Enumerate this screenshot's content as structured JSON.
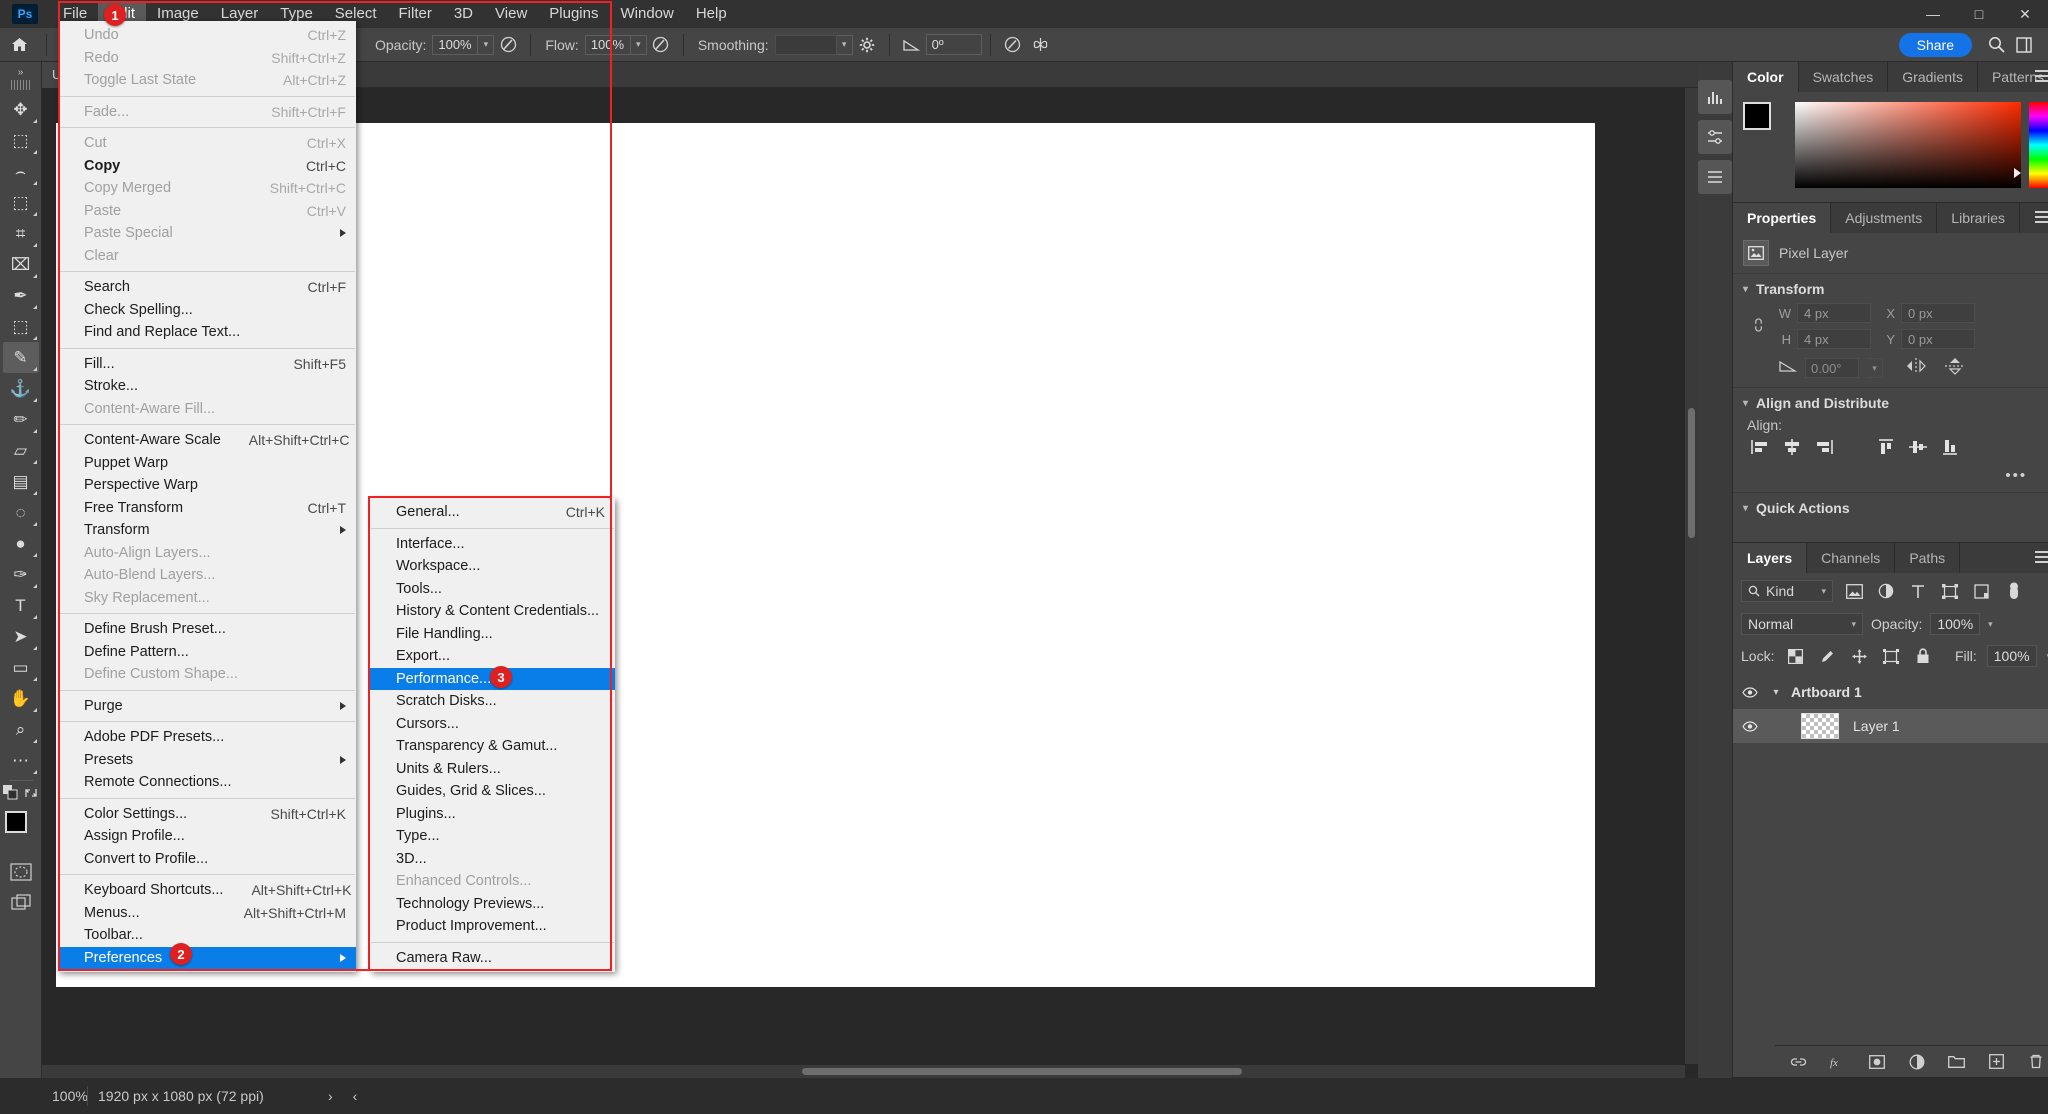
{
  "app": {
    "logo": "Ps"
  },
  "menubar": {
    "items": [
      {
        "label": "File",
        "active": false
      },
      {
        "label": "Edit",
        "active": true
      },
      {
        "label": "Image",
        "active": false
      },
      {
        "label": "Layer",
        "active": false
      },
      {
        "label": "Type",
        "active": false
      },
      {
        "label": "Select",
        "active": false
      },
      {
        "label": "Filter",
        "active": false
      },
      {
        "label": "3D",
        "active": false
      },
      {
        "label": "View",
        "active": false
      },
      {
        "label": "Plugins",
        "active": false
      },
      {
        "label": "Window",
        "active": false
      },
      {
        "label": "Help",
        "active": false
      }
    ]
  },
  "window_controls": {
    "minimize": "—",
    "maximize": "□",
    "close": "✕"
  },
  "options_bar": {
    "opacity_label": "Opacity:",
    "opacity_value": "100%",
    "flow_label": "Flow:",
    "flow_value": "100%",
    "smoothing_label": "Smoothing:",
    "angle_value": "0º",
    "share_label": "Share"
  },
  "document_tab": {
    "label": "U"
  },
  "toolbar": {
    "collapse": "»",
    "tools": [
      {
        "name": "move-tool",
        "glyph": "✥",
        "selected": false
      },
      {
        "name": "rectangular-marquee-tool",
        "glyph": "⬚",
        "selected": false
      },
      {
        "name": "lasso-tool",
        "glyph": "⌢",
        "selected": false
      },
      {
        "name": "object-selection-tool",
        "glyph": "⬚",
        "selected": false
      },
      {
        "name": "crop-tool",
        "glyph": "⌗",
        "selected": false
      },
      {
        "name": "frame-tool",
        "glyph": "⌧",
        "selected": false
      },
      {
        "name": "eyedropper-tool",
        "glyph": "✒",
        "selected": false
      },
      {
        "name": "spot-healing-brush-tool",
        "glyph": "⬚",
        "selected": false
      },
      {
        "name": "brush-tool",
        "glyph": "✎",
        "selected": true
      },
      {
        "name": "clone-stamp-tool",
        "glyph": "⚓",
        "selected": false
      },
      {
        "name": "history-brush-tool",
        "glyph": "✏",
        "selected": false
      },
      {
        "name": "eraser-tool",
        "glyph": "▱",
        "selected": false
      },
      {
        "name": "gradient-tool",
        "glyph": "▤",
        "selected": false
      },
      {
        "name": "blur-tool",
        "glyph": "◌",
        "selected": false
      },
      {
        "name": "dodge-tool",
        "glyph": "●",
        "selected": false
      },
      {
        "name": "pen-tool",
        "glyph": "✑",
        "selected": false
      },
      {
        "name": "horizontal-type-tool",
        "glyph": "T",
        "selected": false
      },
      {
        "name": "path-selection-tool",
        "glyph": "➤",
        "selected": false
      },
      {
        "name": "rectangle-tool",
        "glyph": "▭",
        "selected": false
      },
      {
        "name": "hand-tool",
        "glyph": "✋",
        "selected": false
      },
      {
        "name": "zoom-tool",
        "glyph": "⌕",
        "selected": false
      },
      {
        "name": "edit-toolbar-tool",
        "glyph": "⋯",
        "selected": false
      }
    ]
  },
  "edit_menu": {
    "items": [
      {
        "label": "Undo",
        "shortcut": "Ctrl+Z",
        "dim": true
      },
      {
        "label": "Redo",
        "shortcut": "Shift+Ctrl+Z",
        "dim": true
      },
      {
        "label": "Toggle Last State",
        "shortcut": "Alt+Ctrl+Z",
        "dim": true
      },
      {
        "sep": true
      },
      {
        "label": "Fade...",
        "shortcut": "Shift+Ctrl+F",
        "dim": true
      },
      {
        "sep": true
      },
      {
        "label": "Cut",
        "shortcut": "Ctrl+X",
        "dim": true
      },
      {
        "label": "Copy",
        "shortcut": "Ctrl+C",
        "dim": false,
        "bold": true
      },
      {
        "label": "Copy Merged",
        "shortcut": "Shift+Ctrl+C",
        "dim": true
      },
      {
        "label": "Paste",
        "shortcut": "Ctrl+V",
        "dim": true
      },
      {
        "label": "Paste Special",
        "shortcut": "",
        "dim": true,
        "submenu": true
      },
      {
        "label": "Clear",
        "shortcut": "",
        "dim": true
      },
      {
        "sep": true
      },
      {
        "label": "Search",
        "shortcut": "Ctrl+F",
        "dim": false
      },
      {
        "label": "Check Spelling...",
        "shortcut": "",
        "dim": false
      },
      {
        "label": "Find and Replace Text...",
        "shortcut": "",
        "dim": false
      },
      {
        "sep": true
      },
      {
        "label": "Fill...",
        "shortcut": "Shift+F5",
        "dim": false
      },
      {
        "label": "Stroke...",
        "shortcut": "",
        "dim": false
      },
      {
        "label": "Content-Aware Fill...",
        "shortcut": "",
        "dim": true
      },
      {
        "sep": true
      },
      {
        "label": "Content-Aware Scale",
        "shortcut": "Alt+Shift+Ctrl+C",
        "dim": false
      },
      {
        "label": "Puppet Warp",
        "shortcut": "",
        "dim": false
      },
      {
        "label": "Perspective Warp",
        "shortcut": "",
        "dim": false
      },
      {
        "label": "Free Transform",
        "shortcut": "Ctrl+T",
        "dim": false
      },
      {
        "label": "Transform",
        "shortcut": "",
        "dim": false,
        "submenu": true
      },
      {
        "label": "Auto-Align Layers...",
        "shortcut": "",
        "dim": true
      },
      {
        "label": "Auto-Blend Layers...",
        "shortcut": "",
        "dim": true
      },
      {
        "label": "Sky Replacement...",
        "shortcut": "",
        "dim": true
      },
      {
        "sep": true
      },
      {
        "label": "Define Brush Preset...",
        "shortcut": "",
        "dim": false
      },
      {
        "label": "Define Pattern...",
        "shortcut": "",
        "dim": false
      },
      {
        "label": "Define Custom Shape...",
        "shortcut": "",
        "dim": true
      },
      {
        "sep": true
      },
      {
        "label": "Purge",
        "shortcut": "",
        "dim": false,
        "submenu": true
      },
      {
        "sep": true
      },
      {
        "label": "Adobe PDF Presets...",
        "shortcut": "",
        "dim": false
      },
      {
        "label": "Presets",
        "shortcut": "",
        "dim": false,
        "submenu": true
      },
      {
        "label": "Remote Connections...",
        "shortcut": "",
        "dim": false
      },
      {
        "sep": true
      },
      {
        "label": "Color Settings...",
        "shortcut": "Shift+Ctrl+K",
        "dim": false
      },
      {
        "label": "Assign Profile...",
        "shortcut": "",
        "dim": false
      },
      {
        "label": "Convert to Profile...",
        "shortcut": "",
        "dim": false
      },
      {
        "sep": true
      },
      {
        "label": "Keyboard Shortcuts...",
        "shortcut": "Alt+Shift+Ctrl+K",
        "dim": false
      },
      {
        "label": "Menus...",
        "shortcut": "Alt+Shift+Ctrl+M",
        "dim": false
      },
      {
        "label": "Toolbar...",
        "shortcut": "",
        "dim": false
      },
      {
        "label": "Preferences",
        "shortcut": "",
        "dim": false,
        "submenu": true,
        "highlight": true
      }
    ]
  },
  "preferences_menu": {
    "items": [
      {
        "label": "General...",
        "shortcut": "Ctrl+K",
        "dim": false
      },
      {
        "sep": true
      },
      {
        "label": "Interface...",
        "shortcut": "",
        "dim": false
      },
      {
        "label": "Workspace...",
        "shortcut": "",
        "dim": false
      },
      {
        "label": "Tools...",
        "shortcut": "",
        "dim": false
      },
      {
        "label": "History & Content Credentials...",
        "shortcut": "",
        "dim": false
      },
      {
        "label": "File Handling...",
        "shortcut": "",
        "dim": false
      },
      {
        "label": "Export...",
        "shortcut": "",
        "dim": false
      },
      {
        "label": "Performance...",
        "shortcut": "",
        "dim": false,
        "highlight": true
      },
      {
        "label": "Scratch Disks...",
        "shortcut": "",
        "dim": false
      },
      {
        "label": "Cursors...",
        "shortcut": "",
        "dim": false
      },
      {
        "label": "Transparency & Gamut...",
        "shortcut": "",
        "dim": false
      },
      {
        "label": "Units & Rulers...",
        "shortcut": "",
        "dim": false
      },
      {
        "label": "Guides, Grid & Slices...",
        "shortcut": "",
        "dim": false
      },
      {
        "label": "Plugins...",
        "shortcut": "",
        "dim": false
      },
      {
        "label": "Type...",
        "shortcut": "",
        "dim": false
      },
      {
        "label": "3D...",
        "shortcut": "",
        "dim": false
      },
      {
        "label": "Enhanced Controls...",
        "shortcut": "",
        "dim": true
      },
      {
        "label": "Technology Previews...",
        "shortcut": "",
        "dim": false
      },
      {
        "label": "Product Improvement...",
        "shortcut": "",
        "dim": false
      },
      {
        "sep": true
      },
      {
        "label": "Camera Raw...",
        "shortcut": "",
        "dim": false
      }
    ]
  },
  "annotations": {
    "badges": [
      {
        "number": "1",
        "target": "edit-menu-title"
      },
      {
        "number": "2",
        "target": "preferences-menu-item"
      },
      {
        "number": "3",
        "target": "performance-menu-item"
      }
    ],
    "accent_color": "#ee2222"
  },
  "color_panel": {
    "tabs": [
      {
        "label": "Color",
        "active": true
      },
      {
        "label": "Swatches",
        "active": false
      },
      {
        "label": "Gradients",
        "active": false
      },
      {
        "label": "Patterns",
        "active": false
      }
    ],
    "foreground": "#000000",
    "background": "#ffffff"
  },
  "properties_panel": {
    "tabs": [
      {
        "label": "Properties",
        "active": true
      },
      {
        "label": "Adjustments",
        "active": false
      },
      {
        "label": "Libraries",
        "active": false
      }
    ],
    "layer_type": "Pixel Layer",
    "transform": {
      "title": "Transform",
      "w_label": "W",
      "w_value": "4 px",
      "h_label": "H",
      "h_value": "4 px",
      "x_label": "X",
      "x_value": "0 px",
      "y_label": "Y",
      "y_value": "0 px",
      "angle_value": "0.00°"
    },
    "align": {
      "title": "Align and Distribute",
      "label": "Align:",
      "more": "•••"
    },
    "quick_actions": {
      "title": "Quick Actions"
    }
  },
  "layers_panel": {
    "tabs": [
      {
        "label": "Layers",
        "active": true
      },
      {
        "label": "Channels",
        "active": false
      },
      {
        "label": "Paths",
        "active": false
      }
    ],
    "filter_kind": "Kind",
    "blend_mode": "Normal",
    "opacity_label": "Opacity:",
    "opacity_value": "100%",
    "lock_label": "Lock:",
    "fill_label": "Fill:",
    "fill_value": "100%",
    "rows": [
      {
        "name": "Artboard 1",
        "type": "group",
        "visible": true,
        "selected": false
      },
      {
        "name": "Layer 1",
        "type": "pixel",
        "visible": true,
        "selected": true
      }
    ]
  },
  "status_bar": {
    "zoom": "100%",
    "doc_info": "1920 px x 1080 px (72 ppi)",
    "next_arrow": "›",
    "prev_arrow": "‹"
  }
}
